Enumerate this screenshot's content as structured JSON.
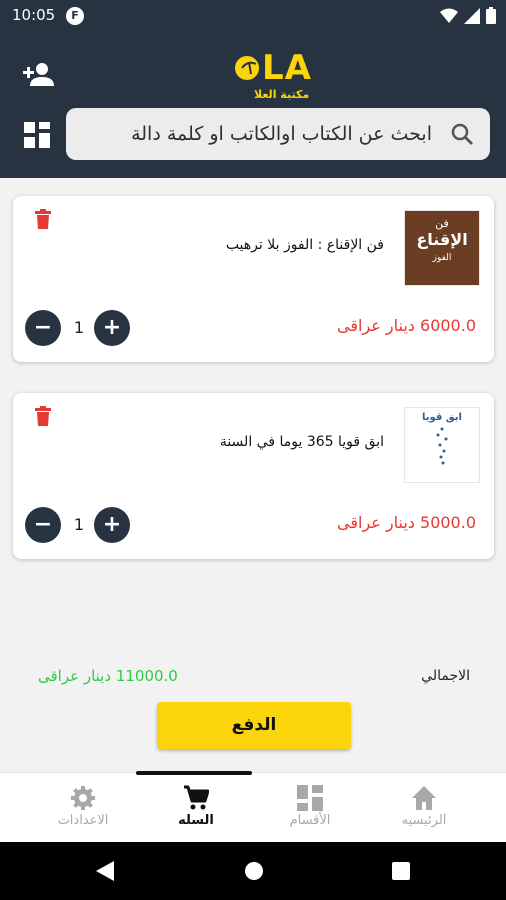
{
  "status_bar": {
    "time": "10:05",
    "app_badge": "F"
  },
  "header": {
    "logo_letters": "LA",
    "logo_caption": "مكتبة العلا",
    "search": {
      "placeholder": "ابحث عن الكتاب اوالكاتب او كلمة دالة"
    }
  },
  "cart": {
    "items": [
      {
        "title": "فن الإقناع : الفوز بلا ترهيب",
        "price": "6000.0 دينار عراقى",
        "quantity": "1",
        "cover": {
          "title_line1": "فن",
          "title_line2": "الإقناع",
          "subtitle": "الفوز",
          "color": "#6b3d22"
        }
      },
      {
        "title": "ابق قويا 365 يوما في السنة",
        "price": "5000.0 دينار عراقى",
        "quantity": "1",
        "cover": {
          "title_line1": "ابق قويا",
          "color": "#2d5f9a"
        }
      }
    ],
    "qty_minus": "−",
    "qty_plus": "+",
    "total_label": "الاجمالي",
    "total_value": "11000.0 دينار عراقى",
    "pay_label": "الدفع"
  },
  "bottom_nav": {
    "items": [
      {
        "label": "الرئيسيه",
        "icon": "home-icon"
      },
      {
        "label": "الأقسام",
        "icon": "categories-icon"
      },
      {
        "label": "السله",
        "icon": "cart-icon",
        "active": true
      },
      {
        "label": "الاعدادات",
        "icon": "gear-icon"
      }
    ]
  },
  "colors": {
    "header_bg": "#273340",
    "price_red": "#e53935",
    "total_green": "#2ecc40",
    "pay_yellow": "#fcd40b"
  }
}
